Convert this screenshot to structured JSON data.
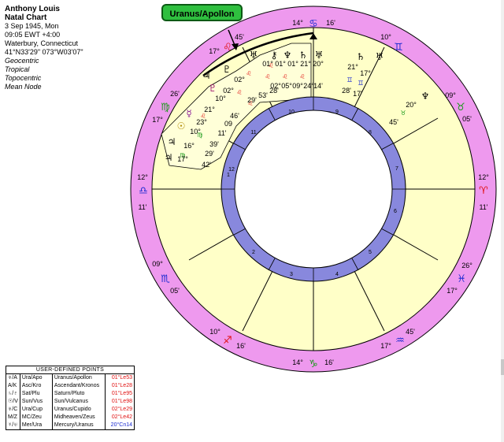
{
  "info": {
    "name": "Anthony Louis",
    "chart_type": "Natal Chart",
    "date": "3 Sep 1945, Mon",
    "time": "09:05  EWT +4:00",
    "place": "Waterbury, Connecticut",
    "coords": "41°N33'29\" 073°W03'07\"",
    "options": [
      "Geocentric",
      "Tropical",
      "Topocentric",
      "Mean Node"
    ]
  },
  "tooltip": "Uranus/Apollon",
  "wheel": {
    "colors": {
      "outer_ring": "#ee99ee",
      "house_band": "#ffffc8",
      "inner_band": "#8888dd",
      "center": "#ffffff"
    },
    "sign_degrees": {
      "top_left": "14°",
      "top_right": "16'",
      "ul1": "17°",
      "ul1m": "45'",
      "ur1": "10°",
      "ur2": "09°",
      "ur2m": "05'",
      "l_deg": "12°",
      "l_min": "11'",
      "r_deg": "12°",
      "r_min": "11'",
      "ll1": "09°",
      "ll1m": "05'",
      "lr1": "26°",
      "lr1m": "17°",
      "bl1": "10°",
      "bl1m": "16'",
      "br1": "45'",
      "br1m": "17°",
      "bottom_left": "14°",
      "bottom_right": "16'",
      "left_upper": "26'",
      "left_upper2": "17°"
    },
    "house_numbers": [
      "1",
      "2",
      "3",
      "4",
      "5",
      "6",
      "7",
      "8",
      "9",
      "10",
      "11",
      "12"
    ],
    "planet_labels": {
      "row1": [
        "01°",
        "01°",
        "01°",
        "21°",
        "20°"
      ],
      "row2": [
        "02°",
        "05°",
        "09°",
        "24°",
        "14'"
      ],
      "row3": [
        "10°",
        "21°",
        "23°",
        "09",
        "11'"
      ],
      "row4": [
        "10°",
        "16°",
        "17°",
        "39'",
        "29'",
        "42'"
      ],
      "mid": [
        "02°",
        "02°",
        "53'",
        "28'",
        "29'",
        "46'"
      ],
      "right_planets": [
        "21°",
        "17°",
        "28'",
        "17'",
        "20°",
        "45'"
      ]
    }
  },
  "udp": {
    "header": "USER-DEFINED POINTS",
    "rows": [
      {
        "abbr": "Ura/Apo",
        "full": "Uranus/Apollon",
        "val": "01°Le53",
        "color": "red",
        "glyph": "♅/A"
      },
      {
        "abbr": "Asc/Kro",
        "full": "Ascendant/Kronos",
        "val": "01°Le28",
        "color": "red",
        "glyph": "A/K"
      },
      {
        "abbr": "Sat/Plu",
        "full": "Saturn/Pluto",
        "val": "01°Le95",
        "color": "red",
        "glyph": "♄/♇"
      },
      {
        "abbr": "Sun/Vus",
        "full": "Sun/Vulcanus",
        "val": "01°Le98",
        "color": "red",
        "glyph": "☉/V"
      },
      {
        "abbr": "Ura/Cup",
        "full": "Uranus/Cupido",
        "val": "02°Le29",
        "color": "red",
        "glyph": "♅/C"
      },
      {
        "abbr": "MC/Zeu",
        "full": "Midheaven/Zeus",
        "val": "02°Le42",
        "color": "red",
        "glyph": "M/Z"
      },
      {
        "abbr": "Mer/Ura",
        "full": "Mercury/Uranus",
        "val": "20°Cn14",
        "color": "blue",
        "glyph": "☿/♅"
      }
    ]
  }
}
